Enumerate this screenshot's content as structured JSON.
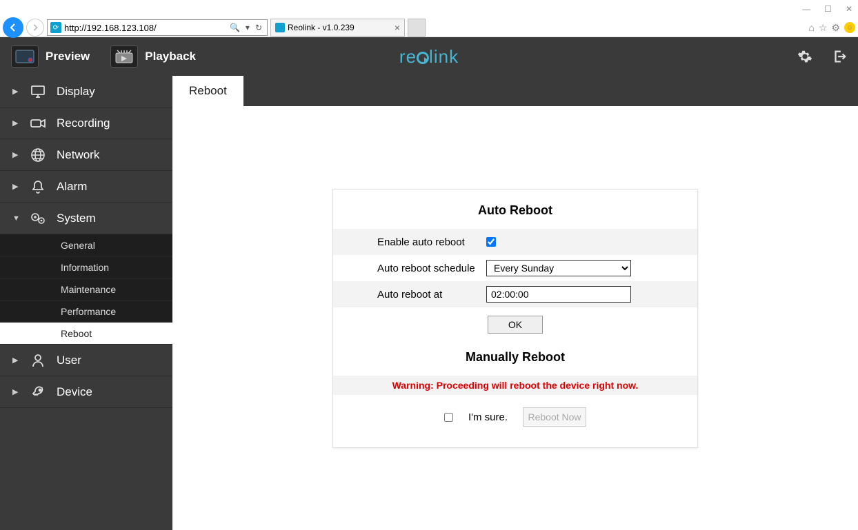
{
  "browser": {
    "url": "http://192.168.123.108/",
    "tab_title": "Reolink - v1.0.239"
  },
  "topnav": {
    "preview": "Preview",
    "playback": "Playback",
    "logo_text": "reolink"
  },
  "sidebar": {
    "display": "Display",
    "recording": "Recording",
    "network": "Network",
    "alarm": "Alarm",
    "system": "System",
    "system_sub": {
      "general": "General",
      "information": "Information",
      "maintenance": "Maintenance",
      "performance": "Performance",
      "reboot": "Reboot"
    },
    "user": "User",
    "device": "Device"
  },
  "page": {
    "tab": "Reboot",
    "auto_title": "Auto Reboot",
    "enable_label": "Enable auto reboot",
    "schedule_label": "Auto reboot schedule",
    "schedule_value": "Every Sunday",
    "time_label": "Auto reboot at",
    "time_value": "02:00:00",
    "ok": "OK",
    "manual_title": "Manually Reboot",
    "warning": "Warning: Proceeding will reboot the device right now.",
    "sure": "I'm sure.",
    "reboot_now": "Reboot Now"
  }
}
